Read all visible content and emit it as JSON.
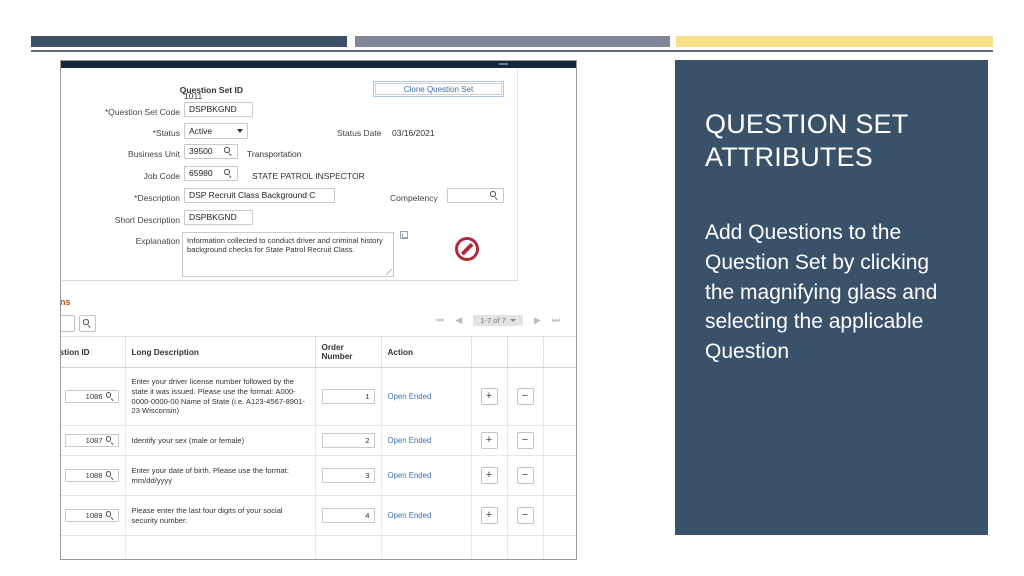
{
  "decor": {
    "band_navy": "#3B4F66",
    "band_gray": "#7F8698",
    "band_gold": "#F6DF88",
    "callout_bg": "#3A5269"
  },
  "form": {
    "clone_button": "Clone Question Set",
    "labels": {
      "question_set_id": "Question Set ID",
      "question_set_code": "*Question Set Code",
      "status": "*Status",
      "status_date": "Status Date",
      "business_unit": "Business Unit",
      "job_code": "Job Code",
      "description": "*Description",
      "competency": "Competency",
      "short_description": "Short Description",
      "explanation": "Explanation"
    },
    "values": {
      "question_set_id": "1011",
      "question_set_code": "DSPBKGND",
      "status": "Active",
      "status_date": "03/16/2021",
      "business_unit": "39500",
      "business_unit_desc": "Transportation",
      "job_code": "65980",
      "job_code_desc": "STATE PATROL INSPECTOR",
      "description": "DSP Recruit Class Background C",
      "competency": "",
      "short_description": "DSPBKGND",
      "explanation": "Information collected to conduct driver and criminal history background checks for State Patrol Recruit Class."
    }
  },
  "questions": {
    "section_title": "tions",
    "pager": {
      "first": "⏮",
      "prev": "◀",
      "count": "1-7 of 7",
      "next": "▶",
      "last": "⏭"
    },
    "columns": {
      "id": "estion ID",
      "long_description": "Long Description",
      "order_number": "Order Number",
      "action": "Action"
    },
    "rows": [
      {
        "id": "1086",
        "long_description": "Enter your driver license number followed by the state it was issued. Please use the format: A000-0000-0000-00 Name of State (i.e. A123-4567-8901-23 Wisconsin)",
        "order_number": "1",
        "action": "Open Ended",
        "add": "+",
        "remove": "−"
      },
      {
        "id": "1087",
        "long_description": "Identify your sex (male or female)",
        "order_number": "2",
        "action": "Open Ended",
        "add": "+",
        "remove": "−"
      },
      {
        "id": "1088",
        "long_description": "Enter your date of birth. Please use the format: mm/dd/yyyy",
        "order_number": "3",
        "action": "Open Ended",
        "add": "+",
        "remove": "−"
      },
      {
        "id": "1089",
        "long_description": "Please enter the last four digits of your social security number.",
        "order_number": "4",
        "action": "Open Ended",
        "add": "+",
        "remove": "−"
      }
    ]
  },
  "callout": {
    "heading": "QUESTION SET ATTRIBUTES",
    "body": "Add Questions to the Question Set by clicking the magnifying glass and selecting the applicable Question"
  }
}
